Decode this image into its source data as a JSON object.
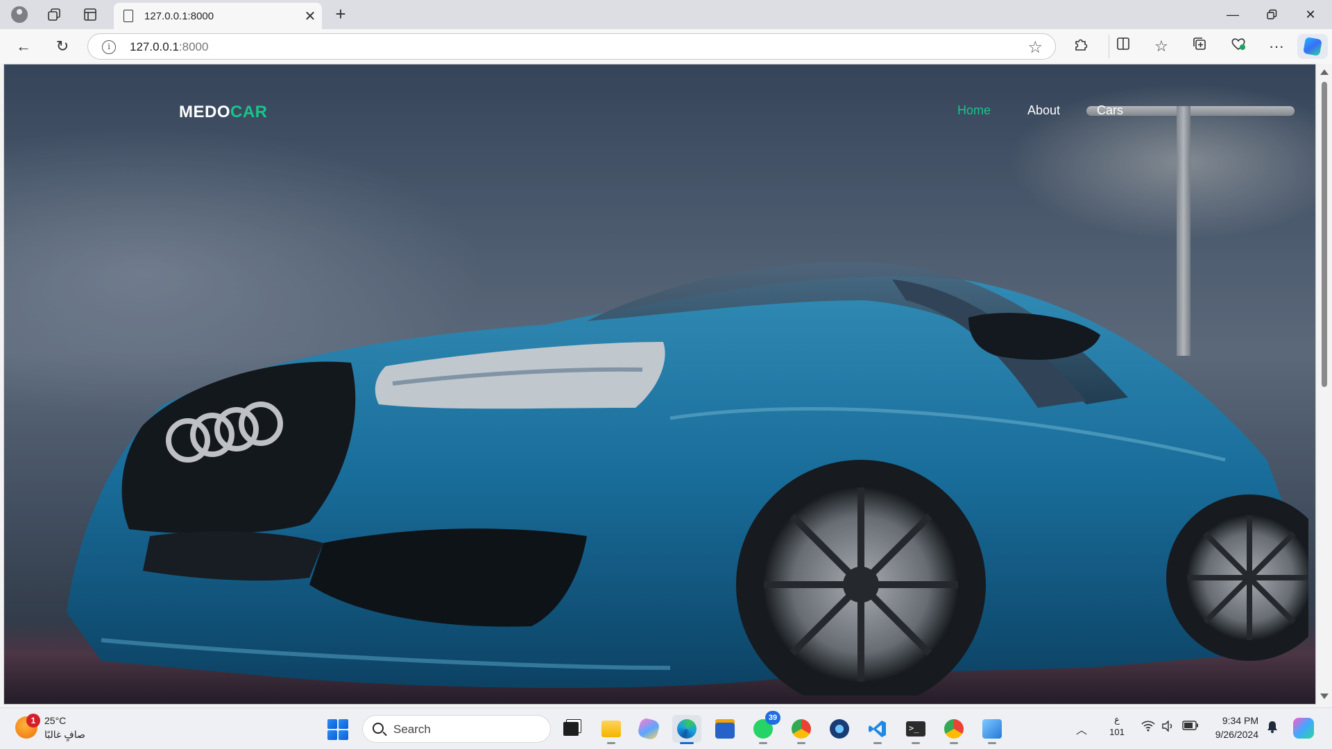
{
  "browser": {
    "tab_title": "127.0.0.1:8000",
    "url_host": "127.0.0.1",
    "url_port": ":8000",
    "icons": [
      "profile-icon",
      "workspaces-icon",
      "vertical-tabs-icon",
      "doc-icon",
      "close-icon",
      "plus-icon",
      "minimize-icon",
      "restore-icon",
      "window-close-icon",
      "back-icon",
      "refresh-icon",
      "info-icon",
      "star-icon",
      "extensions-icon",
      "split-screen-icon",
      "favorites-icon",
      "collections-icon",
      "browser-essentials-icon",
      "more-icon",
      "copilot-icon"
    ]
  },
  "site": {
    "logo_part1": "MEDO",
    "logo_part2": "CAR",
    "nav": {
      "home": "Home",
      "about": "About",
      "cars": "Cars"
    },
    "accent_color": "#19c48a"
  },
  "taskbar": {
    "weather_temp": "25°C",
    "weather_desc": "صافٍ غالبًا",
    "weather_badge": "1",
    "search_label": "Search",
    "whatsapp_badge": "39",
    "lang_top": "ع",
    "lang_bottom": "101",
    "time": "9:34 PM",
    "date": "9/26/2024"
  }
}
